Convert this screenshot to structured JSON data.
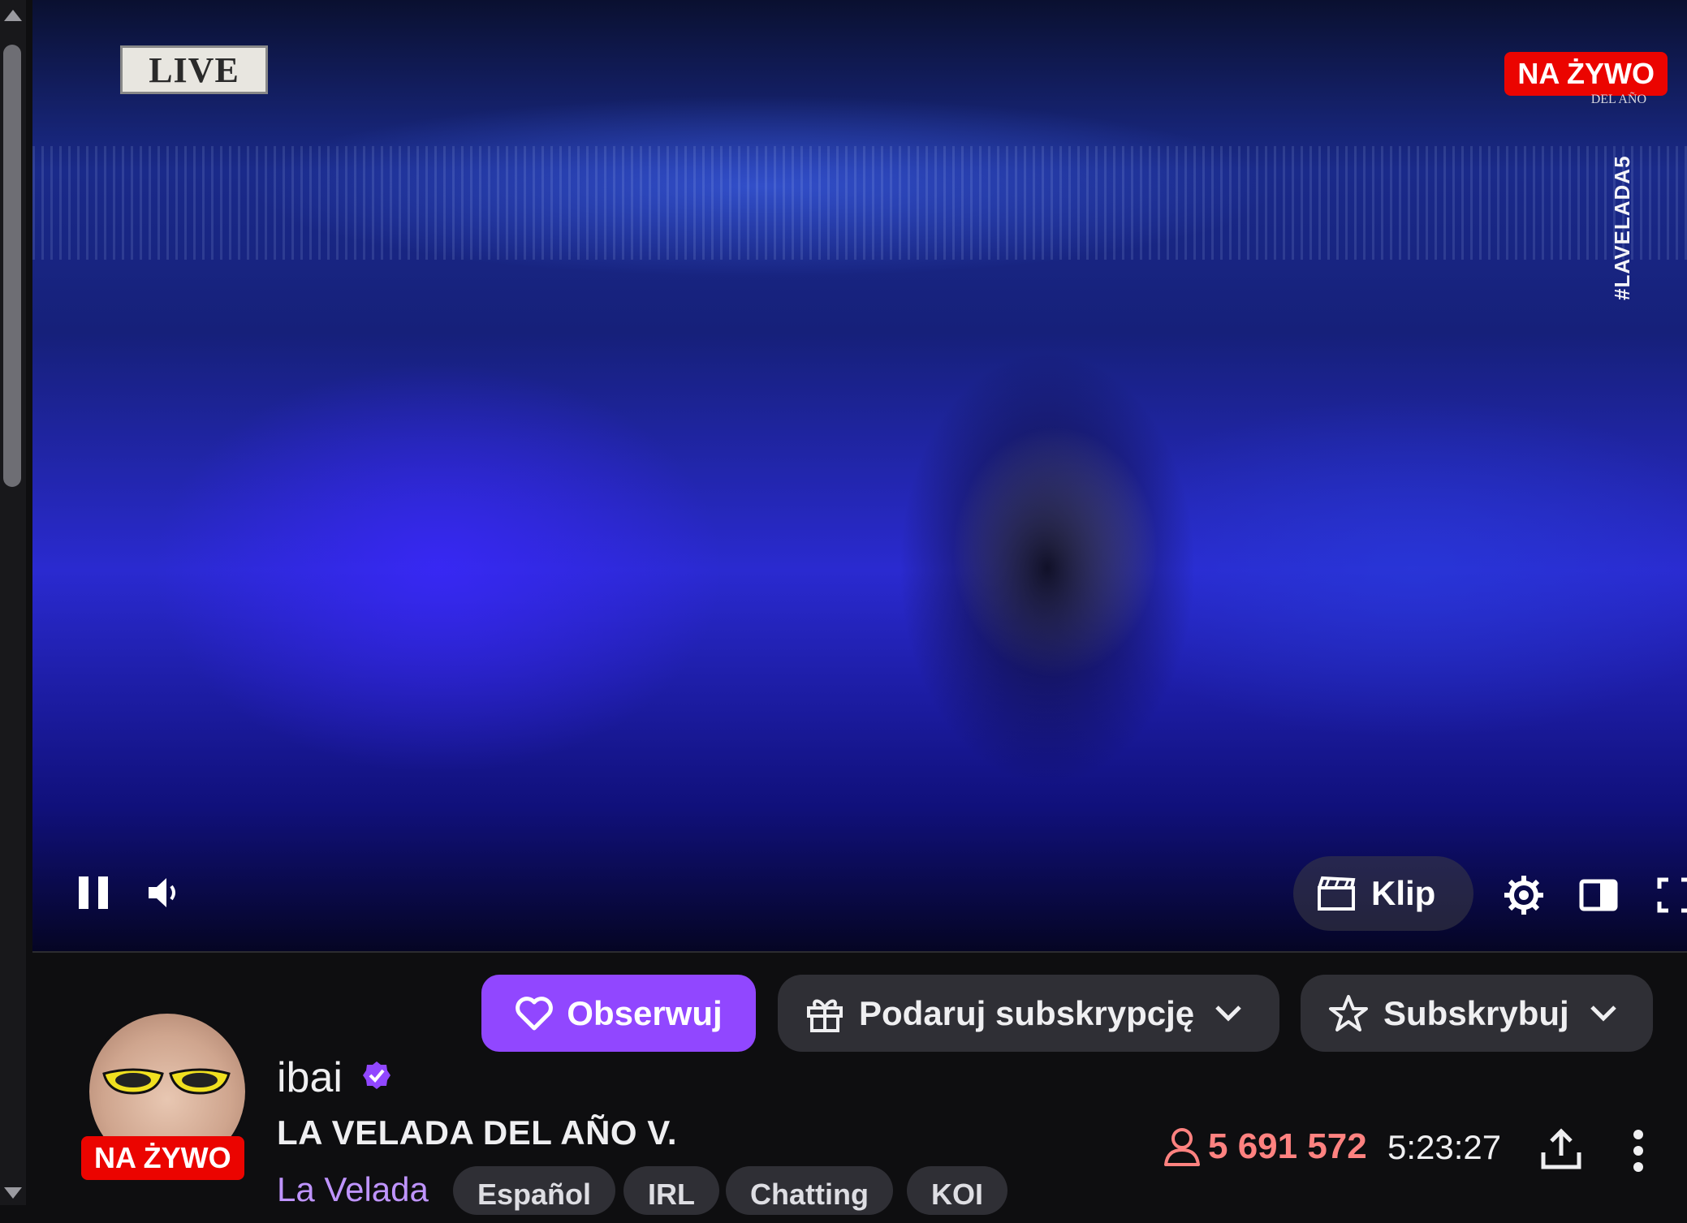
{
  "player": {
    "overlay_logo_text": "LIVE",
    "live_badge": "NA ŻYWO",
    "hashtag": "#LAVELADA5",
    "corner_logo_text": "DEL AÑO",
    "clip_label": "Klip",
    "icons": [
      "pause-icon",
      "volume-icon",
      "clip-icon",
      "settings-icon",
      "theater-mode-icon",
      "fullscreen-icon"
    ]
  },
  "actions": {
    "follow_label": "Obserwuj",
    "gift_label": "Podaruj subskrypcję",
    "subscribe_label": "Subskrybuj"
  },
  "channel": {
    "name": "ibai",
    "live_badge": "NA ŻYWO",
    "title": "LA VELADA DEL AÑO V.",
    "category": "La Velada",
    "tags": [
      "Español",
      "IRL",
      "Chatting",
      "KOI"
    ],
    "viewers": "5 691 572",
    "uptime": "5:23:27"
  },
  "colors": {
    "accent": "#9147ff",
    "live": "#eb0400",
    "viewers": "#ff8280",
    "category": "#bf94ff",
    "background": "#0e0e10"
  }
}
